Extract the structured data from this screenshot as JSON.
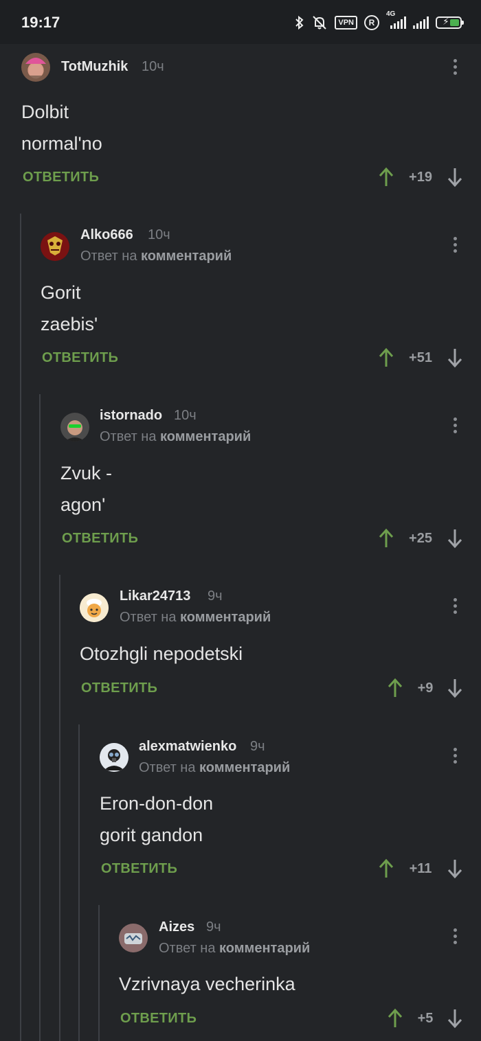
{
  "status_bar": {
    "time": "19:17",
    "network_label": "4G",
    "vpn_label": "VPN",
    "r_label": "R"
  },
  "comments": [
    {
      "username": "TotMuzhik",
      "time": "10ч",
      "reply_prefix": "",
      "reply_target": "",
      "body": "Dolbit\nnormal'no",
      "reply": "ОТВЕТИТЬ",
      "score": "+19",
      "avatar": "pink-hat-portrait"
    },
    {
      "username": "Alko666",
      "time": "10ч",
      "reply_prefix": "Ответ на ",
      "reply_target": "комментарий",
      "body": "Gorit\nzaebis'",
      "reply": "ОТВЕТИТЬ",
      "score": "+51",
      "avatar": "red-yellow-mask"
    },
    {
      "username": "istornado",
      "time": "10ч",
      "reply_prefix": "Ответ на ",
      "reply_target": "комментарий",
      "body": "Zvuk -\nagon'",
      "reply": "ОТВЕТИТЬ",
      "score": "+25",
      "avatar": "man-green-glasses"
    },
    {
      "username": "Likar24713",
      "time": "9ч",
      "reply_prefix": "Ответ на ",
      "reply_target": "комментарий",
      "body": "Otozhgli nepodetski",
      "reply": "ОТВЕТИТЬ",
      "score": "+9",
      "avatar": "cartoon-chef"
    },
    {
      "username": "alexmatwienko",
      "time": "9ч",
      "reply_prefix": "Ответ на ",
      "reply_target": "комментарий",
      "body": "Eron-don-don\ngorit gandon",
      "reply": "ОТВЕТИТЬ",
      "score": "+11",
      "avatar": "gasmask-figure"
    },
    {
      "username": "Aizes",
      "time": "9ч",
      "reply_prefix": "Ответ на ",
      "reply_target": "комментарий",
      "body": "Vzrivnaya vecherinka",
      "reply": "ОТВЕТИТЬ",
      "score": "+5",
      "avatar": "graffiti-badge"
    }
  ],
  "colors": {
    "background": "#232528",
    "accent_green": "#6e9e4d",
    "muted": "#7c7f84"
  }
}
